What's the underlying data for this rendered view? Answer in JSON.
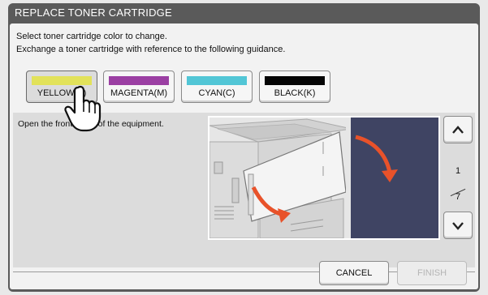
{
  "window": {
    "title": "REPLACE TONER CARTRIDGE"
  },
  "instructions": {
    "line1": "Select toner cartridge color to change.",
    "line2": "Exchange a toner cartridge with reference to the following guidance."
  },
  "color_buttons": [
    {
      "label": "YELLOW(Y)",
      "color": "#e2e25a",
      "selected": true
    },
    {
      "label": "MAGENTA(M)",
      "color": "#9b3fa3",
      "selected": false
    },
    {
      "label": "CYAN(C)",
      "color": "#52c6d6",
      "selected": false
    },
    {
      "label": "BLACK(K)",
      "color": "#050505",
      "selected": false
    }
  ],
  "guide": {
    "text": "Open the front cover of the equipment.",
    "page_current": "1",
    "page_total": "7"
  },
  "footer": {
    "cancel_label": "CANCEL",
    "finish_label": "FINISH"
  },
  "colors": {
    "frame": "#5a5a5a",
    "arrow": "#e8522a",
    "dark_bg": "#3f4463"
  },
  "icons": {
    "pointer": "hand-pointer-icon",
    "up": "chevron-up-icon",
    "down": "chevron-down-icon"
  }
}
